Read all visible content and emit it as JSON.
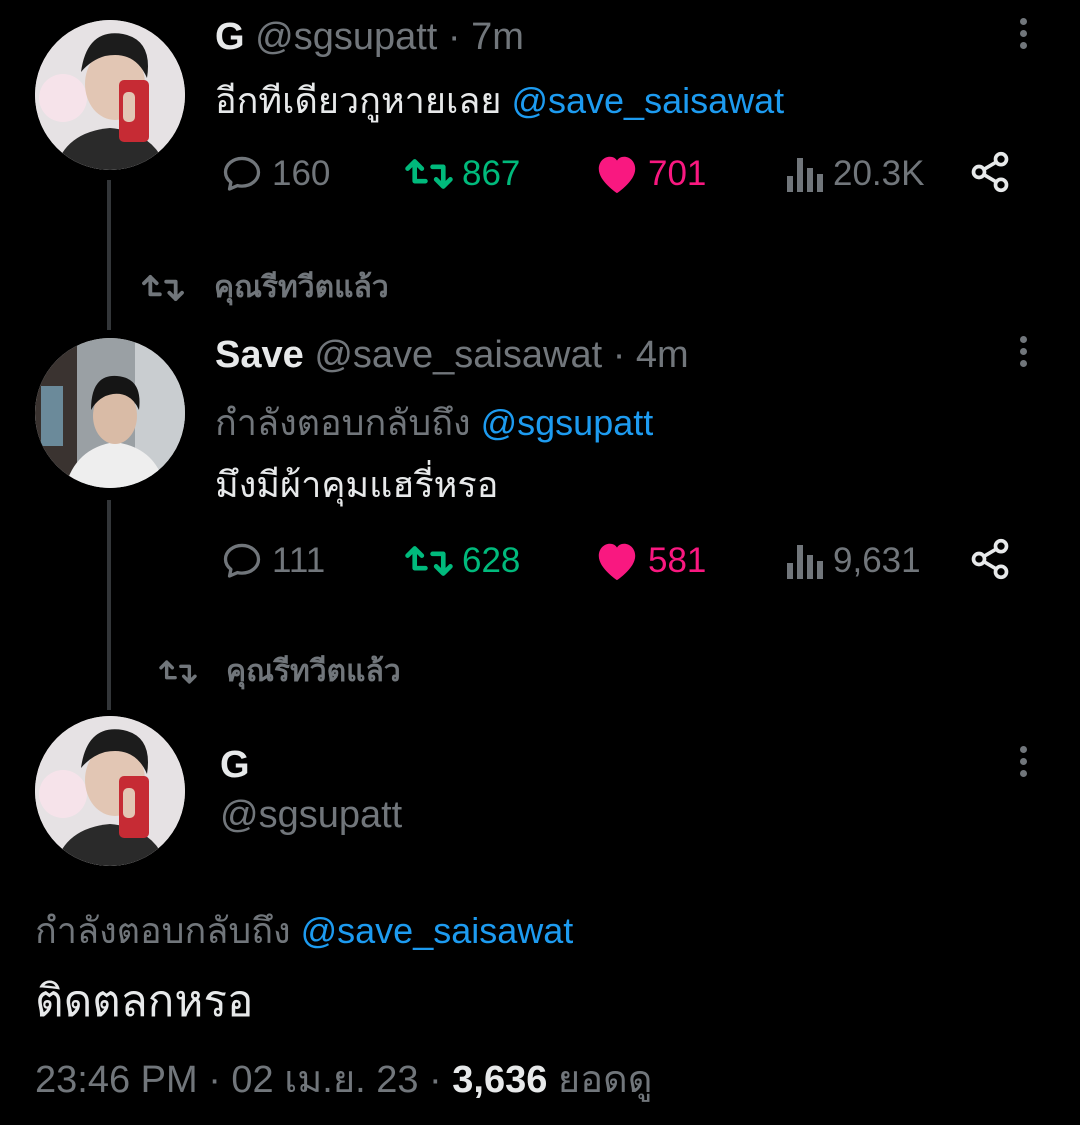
{
  "tweet1": {
    "display_name": "G",
    "handle": "@sgsupatt",
    "time": "· 7m",
    "text": "อีกทีเดียวกูหายเลย",
    "mention": "@save_saisawat",
    "replies": "160",
    "retweets": "867",
    "likes": "701",
    "views": "20.3K"
  },
  "retweet_notice_1": "คุณรีทวีตแล้ว",
  "tweet2": {
    "display_name": "Save",
    "handle": "@save_saisawat",
    "time": "· 4m",
    "replying_prefix": "กำลังตอบกลับถึง",
    "replying_to": "@sgsupatt",
    "text": "มึงมีผ้าคุมแฮรี่หรอ",
    "replies": "111",
    "retweets": "628",
    "likes": "581",
    "views": "9,631"
  },
  "retweet_notice_2": "คุณรีทวีตแล้ว",
  "main_tweet": {
    "display_name": "G",
    "handle": "@sgsupatt",
    "replying_prefix": "กำลังตอบกลับถึง",
    "replying_to": "@save_saisawat",
    "text": "ติดตลกหรอ",
    "timestamp": "23:46 PM · 02 เม.ย. 23 ·",
    "view_count": "3,636",
    "view_label": "ยอดดู"
  },
  "colors": {
    "background": "#000000",
    "text": "#e7e9ea",
    "muted": "#71767b",
    "mention": "#1d9bf0",
    "retweet": "#00ba7c",
    "like": "#f91880"
  }
}
